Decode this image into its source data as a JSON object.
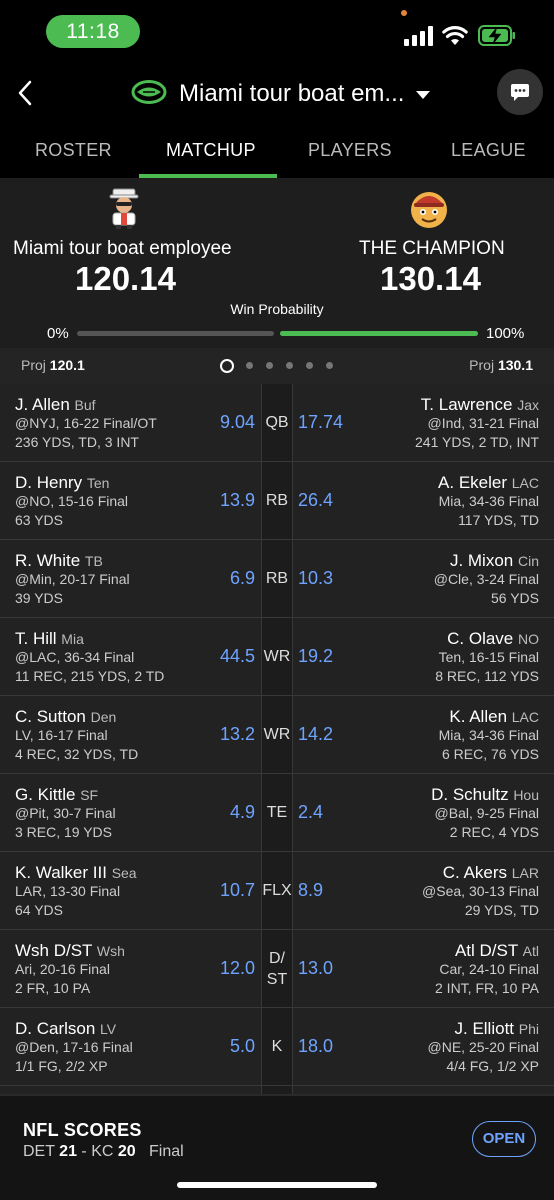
{
  "status_bar": {
    "time": "11:18"
  },
  "header": {
    "league_title": "Miami tour boat em...",
    "icons": [
      "back-chevron-icon",
      "football-icon",
      "caret-down-icon",
      "chat-icon"
    ]
  },
  "tabs": [
    {
      "label": "ROSTER",
      "active": false
    },
    {
      "label": "MATCHUP",
      "active": true
    },
    {
      "label": "PLAYERS",
      "active": false
    },
    {
      "label": "LEAGUE",
      "active": false
    }
  ],
  "matchup": {
    "home": {
      "name": "Miami tour boat employee",
      "score": "120.14",
      "proj_label": "Proj",
      "proj": "120.1"
    },
    "away": {
      "name": "THE CHAMPION",
      "score": "130.14",
      "proj_label": "Proj",
      "proj": "130.1"
    },
    "win_probability": {
      "label": "Win Probability",
      "left_pct": "0%",
      "right_pct": "100%",
      "left_value": 0,
      "right_value": 100
    }
  },
  "lineup": [
    {
      "pos": "QB",
      "l": {
        "name": "J. Allen",
        "team": "Buf",
        "game": "@NYJ, 16-22 Final/OT",
        "stats": "236 YDS, TD, 3 INT",
        "pts": "9.04"
      },
      "r": {
        "name": "T. Lawrence",
        "team": "Jax",
        "game": "@Ind, 31-21 Final",
        "stats": "241 YDS, 2 TD, INT",
        "pts": "17.74"
      }
    },
    {
      "pos": "RB",
      "l": {
        "name": "D. Henry",
        "team": "Ten",
        "game": "@NO, 15-16 Final",
        "stats": "63 YDS",
        "pts": "13.9"
      },
      "r": {
        "name": "A. Ekeler",
        "team": "LAC",
        "game": "Mia, 34-36 Final",
        "stats": "117 YDS, TD",
        "pts": "26.4"
      }
    },
    {
      "pos": "RB",
      "l": {
        "name": "R. White",
        "team": "TB",
        "game": "@Min, 20-17 Final",
        "stats": "39 YDS",
        "pts": "6.9"
      },
      "r": {
        "name": "J. Mixon",
        "team": "Cin",
        "game": "@Cle, 3-24 Final",
        "stats": "56 YDS",
        "pts": "10.3"
      }
    },
    {
      "pos": "WR",
      "l": {
        "name": "T. Hill",
        "team": "Mia",
        "game": "@LAC, 36-34 Final",
        "stats": "11 REC, 215 YDS, 2 TD",
        "pts": "44.5"
      },
      "r": {
        "name": "C. Olave",
        "team": "NO",
        "game": "Ten, 16-15 Final",
        "stats": "8 REC, 112 YDS",
        "pts": "19.2"
      }
    },
    {
      "pos": "WR",
      "l": {
        "name": "C. Sutton",
        "team": "Den",
        "game": "LV, 16-17 Final",
        "stats": "4 REC, 32 YDS, TD",
        "pts": "13.2"
      },
      "r": {
        "name": "K. Allen",
        "team": "LAC",
        "game": "Mia, 34-36 Final",
        "stats": "6 REC, 76 YDS",
        "pts": "14.2"
      }
    },
    {
      "pos": "TE",
      "l": {
        "name": "G. Kittle",
        "team": "SF",
        "game": "@Pit, 30-7 Final",
        "stats": "3 REC, 19 YDS",
        "pts": "4.9"
      },
      "r": {
        "name": "D. Schultz",
        "team": "Hou",
        "game": "@Bal, 9-25 Final",
        "stats": "2 REC, 4 YDS",
        "pts": "2.4"
      }
    },
    {
      "pos": "FLX",
      "l": {
        "name": "K. Walker III",
        "team": "Sea",
        "game": "LAR, 13-30 Final",
        "stats": "64 YDS",
        "pts": "10.7"
      },
      "r": {
        "name": "C. Akers",
        "team": "LAR",
        "game": "@Sea, 30-13 Final",
        "stats": "29 YDS, TD",
        "pts": "8.9"
      }
    },
    {
      "pos": "D/ST",
      "l": {
        "name": "Wsh D/ST",
        "team": "Wsh",
        "game": "Ari, 20-16 Final",
        "stats": "2 FR, 10 PA",
        "pts": "12.0"
      },
      "r": {
        "name": "Atl D/ST",
        "team": "Atl",
        "game": "Car, 24-10 Final",
        "stats": "2 INT, FR, 10 PA",
        "pts": "13.0"
      }
    },
    {
      "pos": "K",
      "l": {
        "name": "D. Carlson",
        "team": "LV",
        "game": "@Den, 17-16 Final",
        "stats": "1/1 FG, 2/2 XP",
        "pts": "5.0"
      },
      "r": {
        "name": "J. Elliott",
        "team": "Phi",
        "game": "@NE, 25-20 Final",
        "stats": "4/4 FG, 1/2 XP",
        "pts": "18.0"
      }
    }
  ],
  "pos_split": {
    "dst_top": "D/",
    "dst_bottom": "ST"
  },
  "banner": {
    "title": "NFL SCORES",
    "team1": "DET",
    "score1": "21",
    "separator": "-",
    "team2": "KC",
    "score2": "20",
    "status": "Final",
    "button": "OPEN"
  },
  "colors": {
    "accent_green": "#4cbb52",
    "points_blue": "#6ea4ff",
    "background": "#1a1a1a"
  }
}
